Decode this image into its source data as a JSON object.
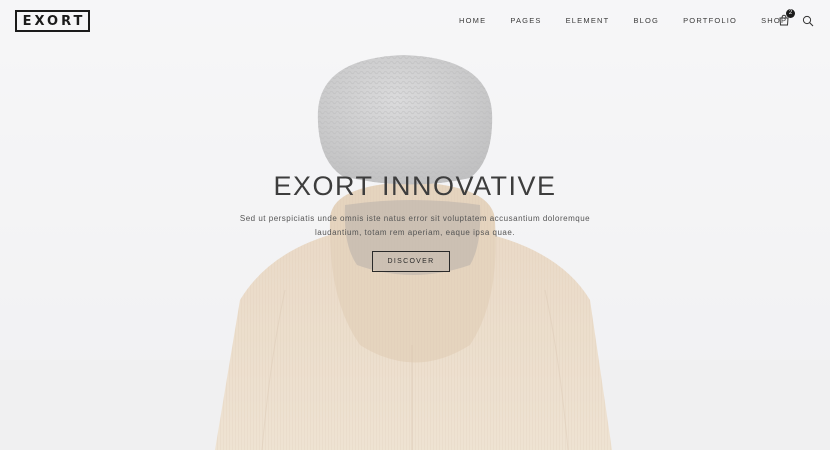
{
  "brand": {
    "logo_text": "EXORT"
  },
  "nav": {
    "items": [
      "HOME",
      "PAGES",
      "ELEMENT",
      "BLOG",
      "PORTFOLIO",
      "SHOP"
    ]
  },
  "cart": {
    "count": "2",
    "icon": "shopping-bag-icon"
  },
  "search": {
    "icon": "search-icon"
  },
  "hero": {
    "title": "EXORT INNOVATIVE",
    "text_line_1": "Sed ut perspiciatis unde omnis iste natus error sit voluptatem accusantium doloremque",
    "text_line_2": "laudantium, totam rem aperiam, eaque ipsa quae.",
    "button_label": "DISCOVER"
  },
  "colors": {
    "text_dark": "#1b1b1b",
    "background": "#f1f1f2",
    "jacket": "#d9b98a",
    "beanie": "#8f8f8f"
  }
}
